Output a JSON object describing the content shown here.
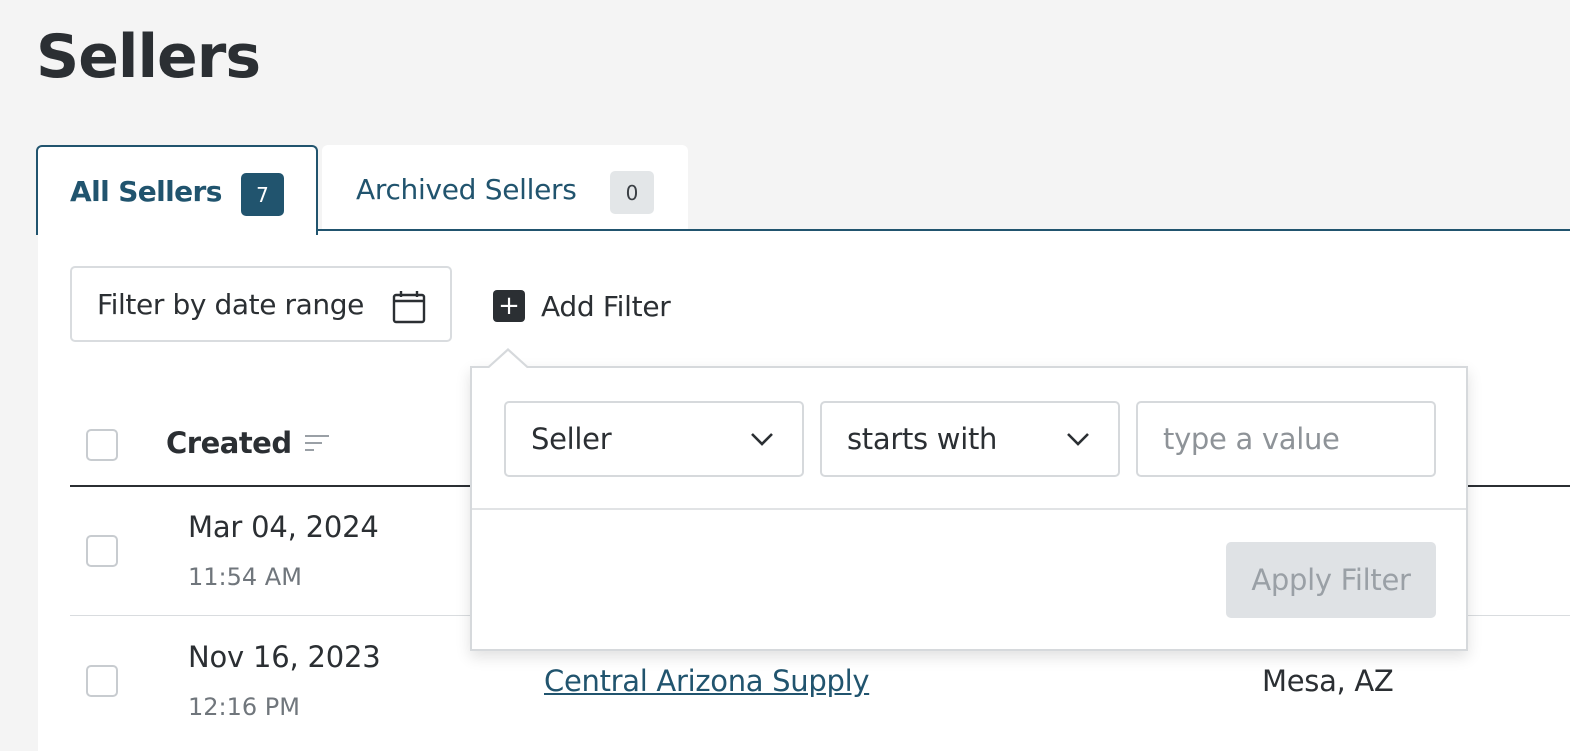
{
  "page": {
    "title": "Sellers"
  },
  "tabs": [
    {
      "label": "All Sellers",
      "count": "7",
      "active": true
    },
    {
      "label": "Archived Sellers",
      "count": "0",
      "active": false
    }
  ],
  "toolbar": {
    "date_filter_label": "Filter by date range",
    "date_filter_icon": "calendar-icon",
    "add_filter_label": "Add Filter",
    "add_filter_icon": "plus-icon"
  },
  "filter_popover": {
    "field_select_value": "Seller",
    "operator_select_value": "starts with",
    "value_placeholder": "type a value",
    "apply_label": "Apply Filter"
  },
  "table": {
    "columns": [
      {
        "label": "Created",
        "sortable": true
      }
    ],
    "rows": [
      {
        "date": "Mar 04, 2024",
        "time": "11:54 AM",
        "seller": "",
        "location": ""
      },
      {
        "date": "Nov 16, 2023",
        "time": "12:16 PM",
        "seller": "Central Arizona Supply",
        "location": "Mesa, AZ"
      }
    ]
  },
  "colors": {
    "accent": "#21546e",
    "text": "#2b2f33",
    "muted": "#70767c",
    "background": "#f4f4f4",
    "button_disabled_bg": "#dfe2e5"
  }
}
